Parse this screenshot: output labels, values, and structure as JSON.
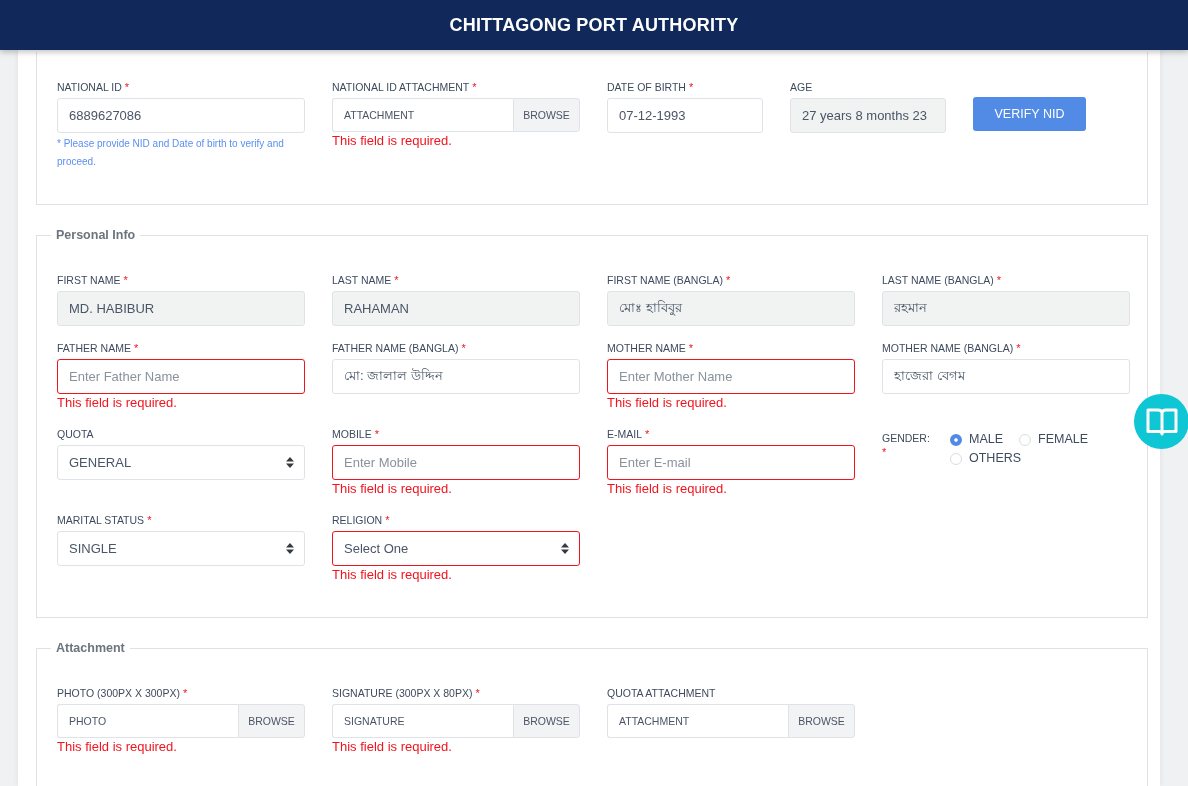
{
  "header": {
    "title": "CHITTAGONG PORT AUTHORITY"
  },
  "sections": [
    {
      "kind": "nid",
      "fields": [
        {
          "kind": "text",
          "label": "NATIONAL ID",
          "required_mark": "*",
          "value": "6889627086",
          "readonly": false,
          "invalid": false,
          "hint": "* Please provide NID and Date of birth to verify and proceed."
        },
        {
          "kind": "file",
          "label": "NATIONAL ID ATTACHMENT",
          "required_mark": "*",
          "value": "ATTACHMENT",
          "button": "BROWSE",
          "error": "This field is required."
        },
        {
          "kind": "text",
          "label": "DATE OF BIRTH",
          "required_mark": "*",
          "value": "07-12-1993",
          "readonly": false,
          "invalid": false
        },
        {
          "kind": "text",
          "label": "AGE",
          "value": "27 years 8 months 23",
          "readonly": true,
          "invalid": false
        },
        {
          "kind": "button",
          "text": "VERIFY NID"
        }
      ]
    },
    {
      "kind": "grid",
      "title": "Personal Info",
      "fields": [
        {
          "kind": "text",
          "label": "FIRST NAME",
          "required_mark": "*",
          "value": "MD. HABIBUR",
          "readonly": true,
          "invalid": false
        },
        {
          "kind": "text",
          "label": "LAST NAME",
          "required_mark": "*",
          "value": "RAHAMAN",
          "readonly": true,
          "invalid": false
        },
        {
          "kind": "text",
          "label": "FIRST NAME (BANGLA)",
          "required_mark": "*",
          "value": "মোঃ হাবিবুর",
          "readonly": true,
          "invalid": false
        },
        {
          "kind": "text",
          "label": "LAST NAME (BANGLA)",
          "required_mark": "*",
          "value": "রহমান",
          "readonly": true,
          "invalid": false
        },
        {
          "kind": "text",
          "label": "FATHER NAME",
          "required_mark": "*",
          "placeholder": "Enter Father Name",
          "readonly": false,
          "invalid": true,
          "error": "This field is required."
        },
        {
          "kind": "text",
          "label": "FATHER NAME (BANGLA)",
          "required_mark": "*",
          "value": "মো: জালাল উদ্দিন",
          "readonly": false,
          "invalid": false
        },
        {
          "kind": "text",
          "label": "MOTHER NAME",
          "required_mark": "*",
          "placeholder": "Enter Mother Name",
          "readonly": false,
          "invalid": true,
          "error": "This field is required."
        },
        {
          "kind": "text",
          "label": "MOTHER NAME (BANGLA)",
          "required_mark": "*",
          "value": "হাজেরা বেগম",
          "readonly": false,
          "invalid": false
        },
        {
          "kind": "select",
          "label": "QUOTA",
          "value": "GENERAL",
          "invalid": false
        },
        {
          "kind": "text",
          "label": "MOBILE",
          "required_mark": "*",
          "placeholder": "Enter Mobile",
          "readonly": false,
          "invalid": true,
          "error": "This field is required."
        },
        {
          "kind": "text",
          "label": "E-MAIL",
          "required_mark": "*",
          "placeholder": "Enter E-mail",
          "readonly": false,
          "invalid": true,
          "error": "This field is required."
        },
        {
          "kind": "radio",
          "label": "GENDER:",
          "required_mark": "*",
          "options": [
            {
              "label": "MALE",
              "selected": true
            },
            {
              "label": "FEMALE",
              "selected": false
            },
            {
              "label": "OTHERS",
              "selected": false
            }
          ]
        },
        {
          "kind": "select",
          "label": "MARITAL STATUS",
          "required_mark": "*",
          "value": "SINGLE",
          "invalid": false
        },
        {
          "kind": "select",
          "label": "RELIGION",
          "required_mark": "*",
          "value": "Select One",
          "invalid": true,
          "error": "This field is required."
        }
      ]
    },
    {
      "kind": "grid",
      "title": "Attachment",
      "fields": [
        {
          "kind": "file",
          "label": "PHOTO (300PX X 300PX)",
          "required_mark": "*",
          "value": "PHOTO",
          "button": "BROWSE",
          "error": "This field is required."
        },
        {
          "kind": "file",
          "label": "SIGNATURE (300PX X 80PX)",
          "required_mark": "*",
          "value": "SIGNATURE",
          "button": "BROWSE",
          "error": "This field is required."
        },
        {
          "kind": "file",
          "label": "QUOTA ATTACHMENT",
          "value": "ATTACHMENT",
          "button": "BROWSE"
        }
      ]
    }
  ]
}
